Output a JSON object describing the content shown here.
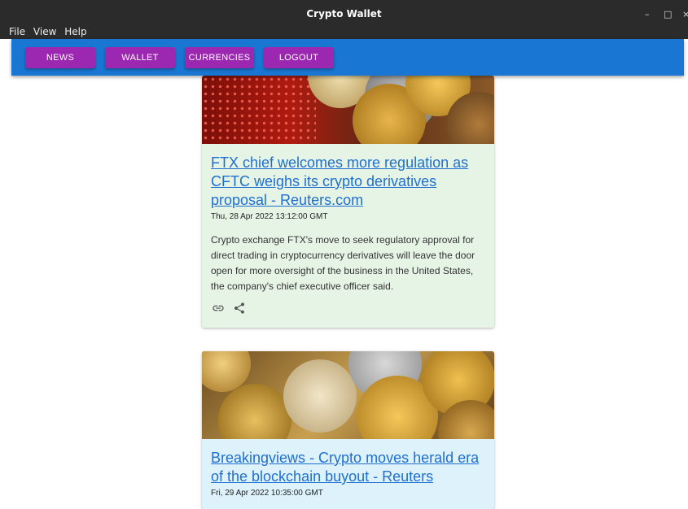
{
  "window": {
    "title": "Crypto Wallet"
  },
  "menu": [
    "File",
    "View",
    "Help"
  ],
  "nav": {
    "news": "NEWS",
    "wallet": "WALLET",
    "currencies": "CURRENCIES",
    "logout": "LOGOUT"
  },
  "colors": {
    "appbar": "#1976d2",
    "button": "#9c27b0",
    "card1_bg": "#e6f4e6",
    "card2_bg": "#def2fb",
    "link": "#1f6fd0"
  },
  "articles": [
    {
      "title": "FTX chief welcomes more regulation as CFTC weighs its crypto derivatives proposal - Reuters.com",
      "date": "Thu, 28 Apr 2022 13:12:00 GMT",
      "description": "Crypto exchange FTX's move to seek regulatory approval for direct trading in cryptocurrency derivatives will leave the door open for more oversight of the business in the United States, the company's chief executive officer said.",
      "icons": [
        "link-icon",
        "share-icon"
      ]
    },
    {
      "title": "Breakingviews - Crypto moves herald era of the blockchain buyout - Reuters",
      "date": "Fri, 29 Apr 2022 10:35:00 GMT"
    }
  ]
}
